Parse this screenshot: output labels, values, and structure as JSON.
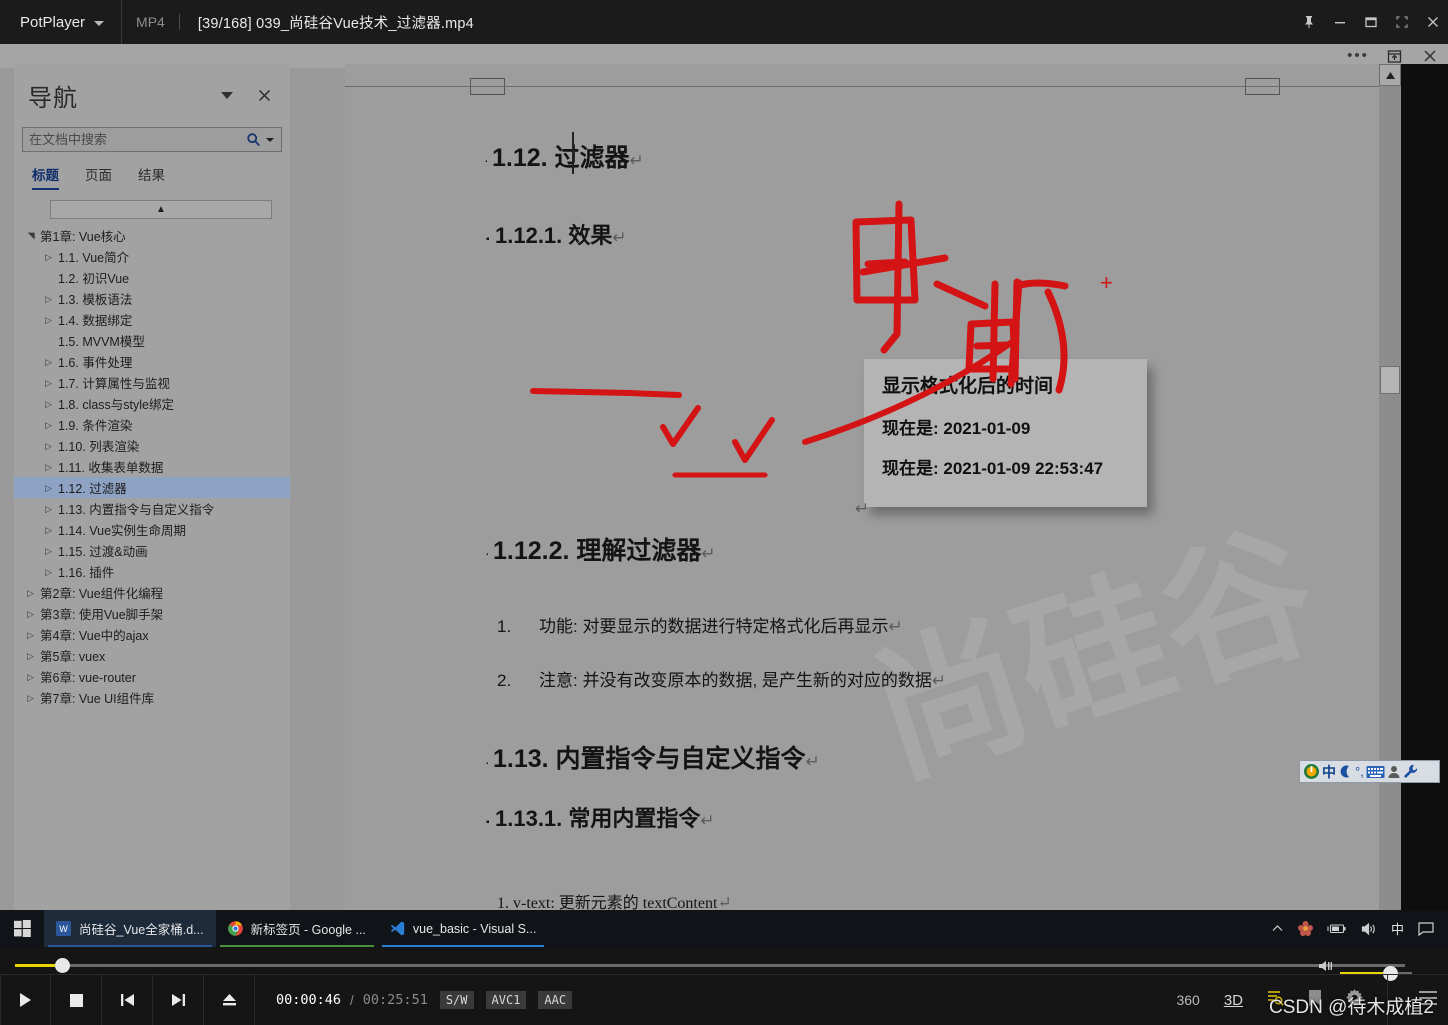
{
  "player": {
    "app_name": "PotPlayer",
    "format": "MP4",
    "file_title": "[39/168] 039_尚硅谷Vue技术_过滤器.mp4",
    "current_time": "00:00:46",
    "separator": "/",
    "total_time": "00:25:51",
    "chips": [
      "S/W",
      "AVC1",
      "AAC"
    ],
    "buttons": {
      "pin": "pin-icon",
      "minimize": "minimize-icon",
      "maximize": "maximize-icon",
      "fullscreen": "fullscreen-icon",
      "close": "close-icon",
      "play": "play-icon",
      "stop": "stop-icon",
      "previous": "previous-icon",
      "next": "next-icon",
      "eject": "eject-icon"
    },
    "right_tools": [
      "360",
      "3D",
      "playlist-icon",
      "bookmark-icon",
      "settings-icon"
    ],
    "watermark": "CSDN @待木成植2",
    "progress_percent": 3,
    "volume_percent": 70
  },
  "word": {
    "top_buttons": {
      "more": "…",
      "restore": "restore-icon",
      "close": "✕"
    },
    "navigation": {
      "title": "导航",
      "search_placeholder": "在文档中搜索",
      "search_value": "",
      "tabs": [
        "标题",
        "页面",
        "结果"
      ],
      "active_tab": "标题",
      "selected_item": "1.12. 过滤器",
      "tree": [
        {
          "label": "第1章: Vue核心",
          "level": 0,
          "twisty": "expanded"
        },
        {
          "label": "1.1. Vue简介",
          "level": 1,
          "twisty": "collapsed"
        },
        {
          "label": "1.2. 初识Vue",
          "level": 1,
          "twisty": "none"
        },
        {
          "label": "1.3. 模板语法",
          "level": 1,
          "twisty": "collapsed"
        },
        {
          "label": "1.4. 数据绑定",
          "level": 1,
          "twisty": "collapsed"
        },
        {
          "label": "1.5. MVVM模型",
          "level": 1,
          "twisty": "none"
        },
        {
          "label": "1.6. 事件处理",
          "level": 1,
          "twisty": "collapsed"
        },
        {
          "label": "1.7. 计算属性与监视",
          "level": 1,
          "twisty": "collapsed"
        },
        {
          "label": "1.8. class与style绑定",
          "level": 1,
          "twisty": "collapsed"
        },
        {
          "label": "1.9. 条件渲染",
          "level": 1,
          "twisty": "collapsed"
        },
        {
          "label": "1.10. 列表渲染",
          "level": 1,
          "twisty": "collapsed"
        },
        {
          "label": "1.11. 收集表单数据",
          "level": 1,
          "twisty": "collapsed"
        },
        {
          "label": "1.12. 过滤器",
          "level": 1,
          "twisty": "collapsed",
          "selected": true
        },
        {
          "label": "1.13. 内置指令与自定义指令",
          "level": 1,
          "twisty": "collapsed"
        },
        {
          "label": "1.14. Vue实例生命周期",
          "level": 1,
          "twisty": "collapsed"
        },
        {
          "label": "1.15. 过渡&动画",
          "level": 1,
          "twisty": "collapsed"
        },
        {
          "label": "1.16. 插件",
          "level": 1,
          "twisty": "collapsed"
        },
        {
          "label": "第2章: Vue组件化编程",
          "level": 0,
          "twisty": "collapsed"
        },
        {
          "label": "第3章: 使用Vue脚手架",
          "level": 0,
          "twisty": "collapsed"
        },
        {
          "label": "第4章: Vue中的ajax",
          "level": 0,
          "twisty": "collapsed"
        },
        {
          "label": "第5章: vuex",
          "level": 0,
          "twisty": "collapsed"
        },
        {
          "label": "第6章: vue-router",
          "level": 0,
          "twisty": "collapsed"
        },
        {
          "label": "第7章: Vue UI组件库",
          "level": 0,
          "twisty": "collapsed"
        }
      ]
    },
    "document": {
      "heading_1": "1.12. 过滤器",
      "heading_2": "1.12.1. 效果",
      "heading_3": "1.12.2. 理解过滤器",
      "list_1_num": "1.",
      "list_1_text": "功能: 对要显示的数据进行特定格式化后再显示",
      "list_2_num": "2.",
      "list_2_text": "注意: 并没有改变原本的数据, 是产生新的对应的数据",
      "heading_4": "1.13. 内置指令与自定义指令",
      "heading_5": "1.13.1. 常用内置指令",
      "para_1": "1. v-text: 更新元素的 textContent",
      "pilcrow": "↵",
      "watermark": "尚硅谷",
      "screenshot": {
        "title": "显示格式化后的时间",
        "line_1": "现在是: 2021-01-09",
        "line_2": "现在是: 2021-01-09 22:53:47"
      },
      "annotation": {
        "handwriting": "时间",
        "color": "#d41414"
      }
    }
  },
  "ime": {
    "items": [
      "sogou-logo-icon",
      "中",
      "moon-icon",
      "comma-icon",
      "keyboard-icon",
      "user-icon",
      "wrench-icon"
    ],
    "mode_label": "中"
  },
  "taskbar": {
    "start": "windows-icon",
    "items": [
      {
        "label": "尚硅谷_Vue全家桶.d...",
        "icon": "word-icon",
        "accent": "#2b579a",
        "active": true
      },
      {
        "label": "新标签页 - Google ...",
        "icon": "chrome-icon",
        "accent": "#4a8f3c",
        "active": false
      },
      {
        "label": "vue_basic - Visual S...",
        "icon": "vscode-icon",
        "accent": "#2a7fd4",
        "active": false
      }
    ],
    "tray": [
      "chevron-up-icon",
      "flower-icon",
      "battery-icon",
      "volume-icon",
      "中",
      "notification-icon"
    ]
  }
}
